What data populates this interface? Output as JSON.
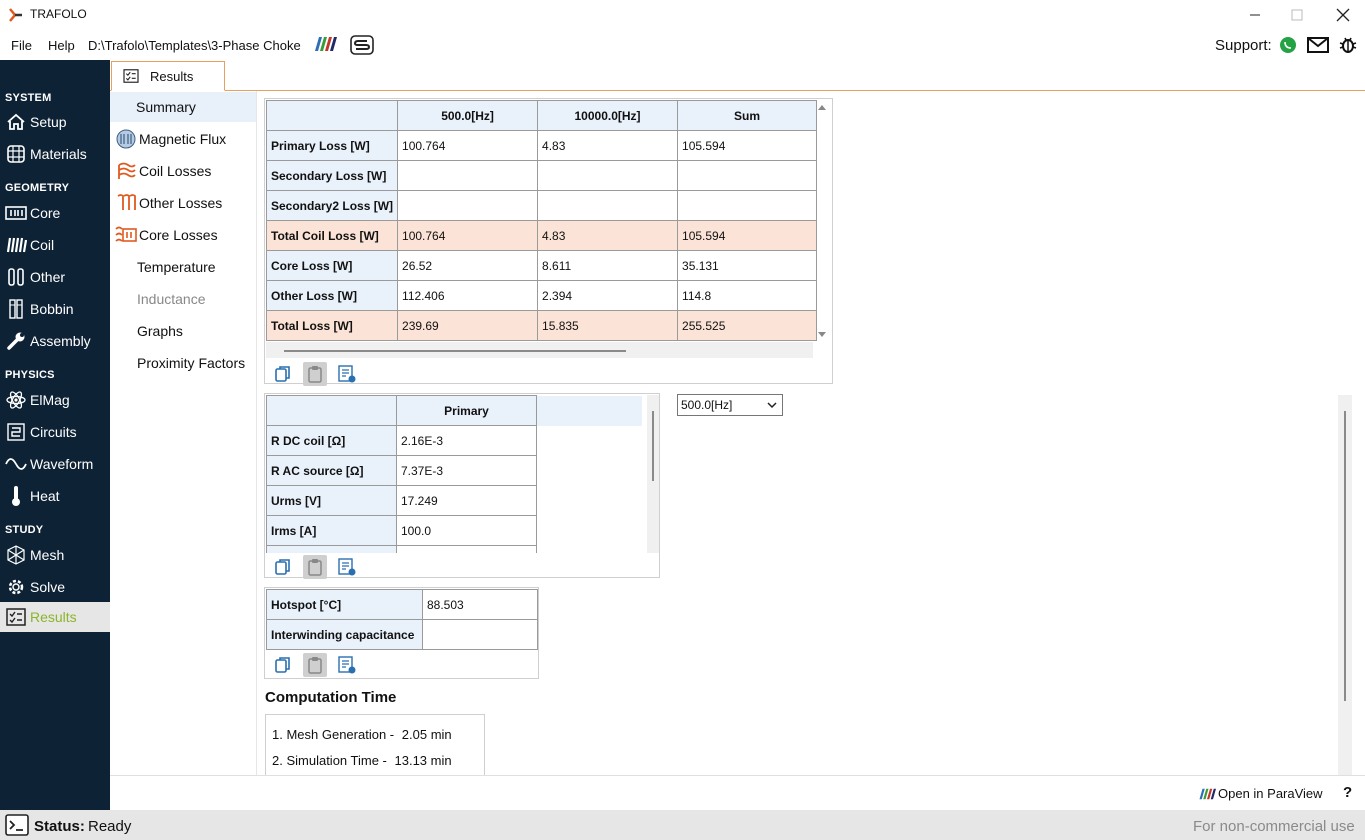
{
  "window": {
    "title": "TRAFOLO"
  },
  "menu": {
    "file": "File",
    "help": "Help",
    "path": "D:\\Trafolo\\Templates\\3-Phase Choke",
    "support": "Support:"
  },
  "sidebar": {
    "sections": [
      "SYSTEM",
      "GEOMETRY",
      "PHYSICS",
      "STUDY"
    ],
    "items": [
      "Setup",
      "Materials",
      "Core",
      "Coil",
      "Other",
      "Bobbin",
      "Assembly",
      "ElMag",
      "Circuits",
      "Waveform",
      "Heat",
      "Mesh",
      "Solve",
      "Results"
    ],
    "active": "Results",
    "active_color": "#8bb52a",
    "bg_color": "#0e2235"
  },
  "tab": {
    "label": "Results"
  },
  "subnav": {
    "items": [
      "Summary",
      "Magnetic Flux",
      "Coil Losses",
      "Other Losses",
      "Core Losses",
      "Temperature",
      "Inductance",
      "Graphs",
      "Proximity Factors"
    ],
    "selected": "Summary",
    "disabled": "Inductance"
  },
  "loss_table": {
    "headers": [
      "",
      "500.0[Hz]",
      "10000.0[Hz]",
      "Sum"
    ],
    "rows": [
      {
        "label": "Primary Loss [W]",
        "values": [
          "100.764",
          "4.83",
          "105.594"
        ],
        "highlight": false
      },
      {
        "label": "Secondary Loss [W]",
        "values": [
          "",
          "",
          ""
        ],
        "highlight": false
      },
      {
        "label": "Secondary2 Loss [W]",
        "values": [
          "",
          "",
          ""
        ],
        "highlight": false
      },
      {
        "label": "Total Coil Loss [W]",
        "values": [
          "100.764",
          "4.83",
          "105.594"
        ],
        "highlight": true
      },
      {
        "label": "Core Loss [W]",
        "values": [
          "26.52",
          "8.611",
          "35.131"
        ],
        "highlight": false
      },
      {
        "label": "Other Loss [W]",
        "values": [
          "112.406",
          "2.394",
          "114.8"
        ],
        "highlight": false
      },
      {
        "label": "Total Loss [W]",
        "values": [
          "239.69",
          "15.835",
          "255.525"
        ],
        "highlight": true
      }
    ],
    "highlight_color": "#fbe3d7"
  },
  "coil_table": {
    "headers": [
      "",
      "Primary"
    ],
    "rows": [
      {
        "label": "R DC coil [Ω]",
        "value": "2.16E-3"
      },
      {
        "label": "R AC source [Ω]",
        "value": "7.37E-3"
      },
      {
        "label": "Urms [V]",
        "value": "17.249"
      },
      {
        "label": "Irms [A]",
        "value": "100.0"
      }
    ]
  },
  "frequency_select": {
    "value": "500.0[Hz]"
  },
  "thermal_table": {
    "rows": [
      {
        "label": "Hotspot [°C]",
        "value": "88.503"
      },
      {
        "label": "Interwinding capacitance",
        "value": ""
      }
    ]
  },
  "computation": {
    "title": "Computation Time",
    "items": [
      {
        "label": "1. Mesh Generation -",
        "value": "2.05",
        "unit": "min"
      },
      {
        "label": "2. Simulation Time -",
        "value": "13.13",
        "unit": "min"
      }
    ]
  },
  "bottom": {
    "paraview": "Open in ParaView",
    "help": "?"
  },
  "status": {
    "label": "Status:",
    "value": "Ready",
    "license": "For non-commercial use"
  }
}
